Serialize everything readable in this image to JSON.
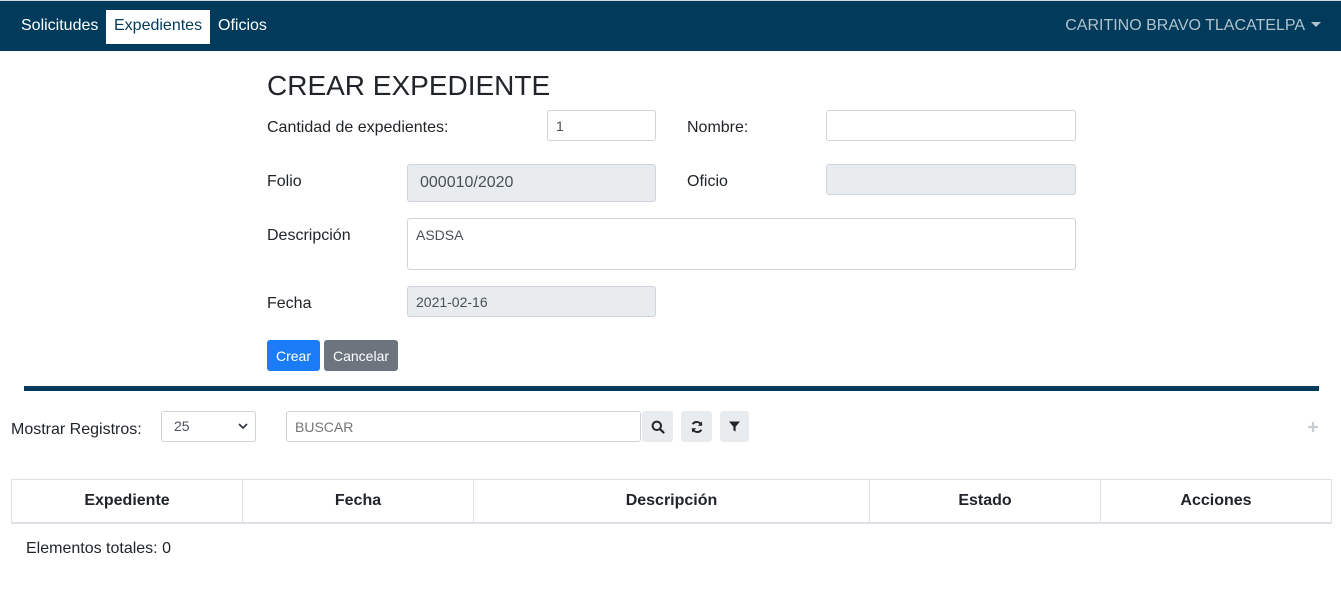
{
  "nav": {
    "items": [
      {
        "label": "Solicitudes",
        "active": false
      },
      {
        "label": "Expedientes",
        "active": true
      },
      {
        "label": "Oficios",
        "active": false
      }
    ],
    "user": "CARITINO BRAVO TLACATELPA"
  },
  "form": {
    "title": "CREAR EXPEDIENTE",
    "cantidad_label": "Cantidad de expedientes:",
    "cantidad_value": "1",
    "nombre_label": "Nombre:",
    "nombre_value": "",
    "folio_label": "Folio",
    "folio_value": "000010/2020",
    "oficio_label": "Oficio",
    "oficio_value": "",
    "descripcion_label": "Descripción",
    "descripcion_value": "ASDSA",
    "fecha_label": "Fecha",
    "fecha_value": "2021-02-16",
    "crear_label": "Crear",
    "cancelar_label": "Cancelar"
  },
  "toolbar": {
    "mostrar_label": "Mostrar Registros:",
    "mostrar_value": "25",
    "search_placeholder": "BUSCAR",
    "icons": [
      "search-icon",
      "refresh-icon",
      "filter-icon",
      "plus-icon"
    ]
  },
  "table": {
    "columns": [
      "Expediente",
      "Fecha",
      "Descripción",
      "Estado",
      "Acciones"
    ],
    "rows": []
  },
  "footer": {
    "total_label": "Elementos totales: 0"
  },
  "colors": {
    "navbar": "#013b5c",
    "primary": "#1b7cf7",
    "secondary": "#6c757d",
    "readonly": "#e9ecef"
  }
}
